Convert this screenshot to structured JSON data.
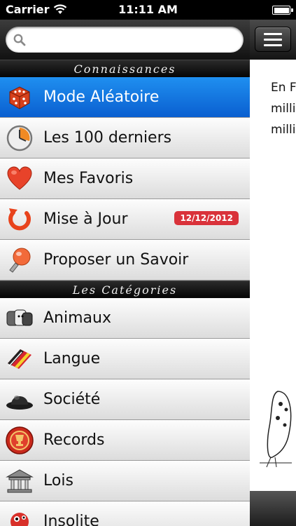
{
  "status": {
    "carrier": "Carrier",
    "time": "11:11 AM"
  },
  "search": {
    "value": "",
    "placeholder": ""
  },
  "sections": {
    "connaissances": "Connaissances",
    "categories": "Les Catégories"
  },
  "menu": {
    "items": [
      {
        "label": "Mode Aléatoire",
        "icon": "dice-icon",
        "selected": true
      },
      {
        "label": "Les 100 derniers",
        "icon": "clock-icon"
      },
      {
        "label": "Mes Favoris",
        "icon": "heart-icon"
      },
      {
        "label": "Mise à Jour",
        "icon": "refresh-icon",
        "badge": "12/12/2012"
      },
      {
        "label": "Proposer un Savoir",
        "icon": "lightbulb-icon"
      }
    ]
  },
  "categories": {
    "items": [
      {
        "label": "Animaux",
        "icon": "animals-icon"
      },
      {
        "label": "Langue",
        "icon": "flags-icon"
      },
      {
        "label": "Société",
        "icon": "bowler-hat-icon"
      },
      {
        "label": "Records",
        "icon": "trophy-medal-icon"
      },
      {
        "label": "Lois",
        "icon": "courthouse-icon"
      },
      {
        "label": "Insolite",
        "icon": "creature-icon"
      }
    ]
  },
  "content": {
    "lines": [
      "En F",
      "millio",
      "millio"
    ]
  },
  "colors": {
    "selected_blue": "#1478e6",
    "badge_red": "#d9323a"
  }
}
